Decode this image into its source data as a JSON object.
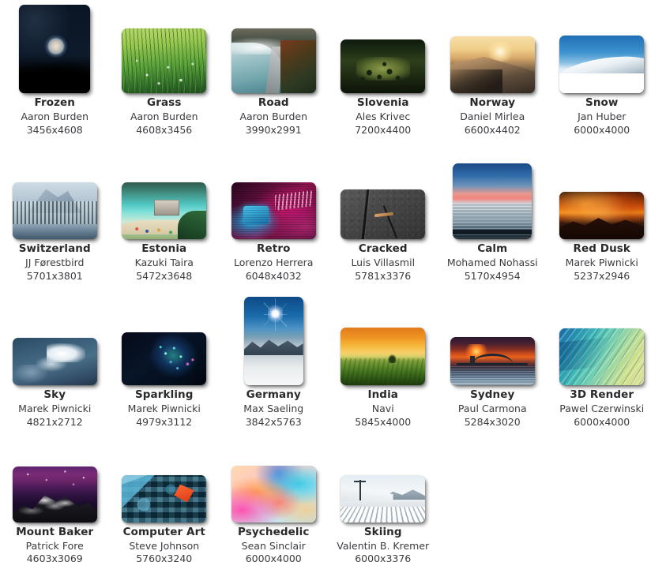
{
  "gallery": {
    "columns": 6,
    "rows": 4,
    "background": "#ffffff",
    "title_color": "#292a2c",
    "meta_color": "#3a3c3f",
    "items": [
      {
        "title": "Frozen",
        "author": "Aaron Burden",
        "dimensions": "3456x4608",
        "orientation": "portrait",
        "thumb_w": 90,
        "thumb_h": 112,
        "art": "moon-bubble-night",
        "c1": "#0b1522",
        "c2": "#243murky",
        "row": 1
      },
      {
        "title": "Grass",
        "author": "Aaron Burden",
        "dimensions": "4608x3456",
        "orientation": "landscape",
        "thumb_w": 107,
        "thumb_h": 82,
        "art": "green-grass-dew",
        "row": 1
      },
      {
        "title": "Road",
        "author": "Aaron Burden",
        "dimensions": "3990x2991",
        "orientation": "landscape",
        "thumb_w": 107,
        "thumb_h": 82,
        "art": "lake-road-autumn",
        "row": 1
      },
      {
        "title": "Slovenia",
        "author": "Ales Krivec",
        "dimensions": "7200x4400",
        "orientation": "landscape",
        "thumb_w": 107,
        "thumb_h": 68,
        "art": "dark-valley-meadow",
        "row": 1
      },
      {
        "title": "Norway",
        "author": "Daniel Mirlea",
        "dimensions": "6600x4402",
        "orientation": "landscape",
        "thumb_w": 107,
        "thumb_h": 72,
        "art": "golden-dune-sunrise",
        "row": 1
      },
      {
        "title": "Snow",
        "author": "Jan Huber",
        "dimensions": "6000x4000",
        "orientation": "landscape",
        "thumb_w": 107,
        "thumb_h": 73,
        "art": "blue-sky-white-dune",
        "row": 1
      },
      {
        "title": "Switzerland",
        "author": "JJ Førestbird",
        "dimensions": "5701x3801",
        "orientation": "landscape",
        "thumb_w": 107,
        "thumb_h": 72,
        "art": "snowy-forest-lake",
        "row": 2
      },
      {
        "title": "Estonia",
        "author": "Kazuki Taira",
        "dimensions": "5472x3648",
        "orientation": "landscape",
        "thumb_w": 107,
        "thumb_h": 72,
        "art": "turquoise-lagoon-ruin",
        "row": 2
      },
      {
        "title": "Retro",
        "author": "Lorenzo Herrera",
        "dimensions": "6048x4032",
        "orientation": "landscape",
        "thumb_w": 107,
        "thumb_h": 72,
        "art": "neon-retro-computer",
        "row": 2
      },
      {
        "title": "Cracked",
        "author": "Luis Villasmil",
        "dimensions": "5781x3376",
        "orientation": "landscape",
        "thumb_w": 107,
        "thumb_h": 63,
        "art": "cracked-asphalt",
        "row": 2
      },
      {
        "title": "Calm",
        "author": "Mohamed Nohassi",
        "dimensions": "5170x4954",
        "orientation": "square",
        "thumb_w": 100,
        "thumb_h": 96,
        "art": "pink-sunset-sea",
        "row": 2
      },
      {
        "title": "Red Dusk",
        "author": "Marek Piwnicki",
        "dimensions": "5237x2946",
        "orientation": "landscape",
        "thumb_w": 107,
        "thumb_h": 60,
        "art": "orange-dusk-mountains",
        "row": 2
      },
      {
        "title": "Sky",
        "author": "Marek Piwnicki",
        "dimensions": "4821x2712",
        "orientation": "landscape",
        "thumb_w": 107,
        "thumb_h": 60,
        "art": "cloud-blue-sky",
        "row": 3
      },
      {
        "title": "Sparkling",
        "author": "Marek Piwnicki",
        "dimensions": "4979x3112",
        "orientation": "landscape",
        "thumb_w": 107,
        "thumb_h": 67,
        "art": "dark-sparkle-particles",
        "row": 3
      },
      {
        "title": "Germany",
        "author": "Max Saeling",
        "dimensions": "3842x5763",
        "orientation": "portrait",
        "thumb_w": 75,
        "thumb_h": 112,
        "art": "sun-star-snow-peaks",
        "row": 3
      },
      {
        "title": "India",
        "author": "Navi",
        "dimensions": "5845x4000",
        "orientation": "landscape",
        "thumb_w": 107,
        "thumb_h": 73,
        "art": "orange-sky-green-field",
        "row": 3
      },
      {
        "title": "Sydney",
        "author": "Paul Carmona",
        "dimensions": "5284x3020",
        "orientation": "landscape",
        "thumb_w": 107,
        "thumb_h": 61,
        "art": "harbour-bridge-sunset",
        "row": 3
      },
      {
        "title": "3D Render",
        "author": "Pawel Czerwinski",
        "dimensions": "6000x4000",
        "orientation": "landscape",
        "thumb_w": 107,
        "thumb_h": 72,
        "art": "teal-flowing-waves",
        "row": 3
      },
      {
        "title": "Mount Baker",
        "author": "Patrick Fore",
        "dimensions": "4603x3069",
        "orientation": "landscape",
        "thumb_w": 107,
        "thumb_h": 71,
        "art": "purple-sky-mountain",
        "row": 4
      },
      {
        "title": "Computer Art",
        "author": "Steve Johnson",
        "dimensions": "5760x3240",
        "orientation": "landscape",
        "thumb_w": 107,
        "thumb_h": 60,
        "art": "blue-cubes-abstract",
        "row": 4
      },
      {
        "title": "Psychedelic",
        "author": "Sean Sinclair",
        "dimensions": "6000x4000",
        "orientation": "landscape",
        "thumb_w": 107,
        "thumb_h": 72,
        "art": "pastel-psychedelic-blur",
        "row": 4
      },
      {
        "title": "Skiing",
        "author": "Valentin B. Kremer",
        "dimensions": "6000x3376",
        "orientation": "landscape",
        "thumb_w": 107,
        "thumb_h": 60,
        "art": "ski-slope-groomed-snow",
        "row": 4
      }
    ]
  }
}
